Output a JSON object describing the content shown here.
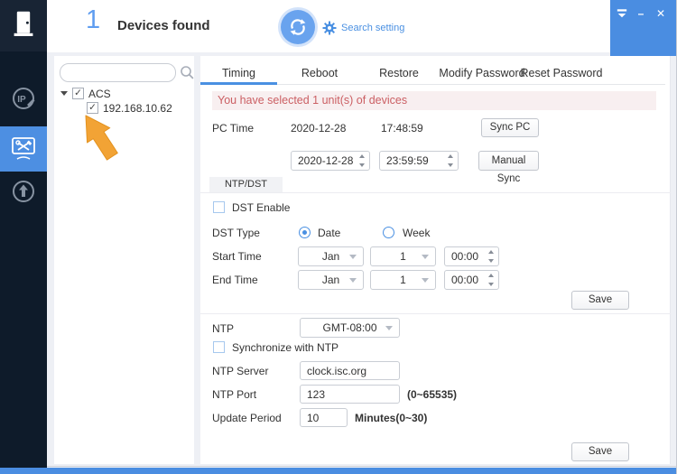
{
  "colors": {
    "accent": "#4a90e2",
    "sidebar_bg": "#0e1b2a",
    "active_tile": "#4d8fe2",
    "titlebar_box": "#4a8de1",
    "banner_bg": "#f8eff0",
    "banner_text": "#cb5f63",
    "arrow_orange": "#f2a335"
  },
  "header": {
    "count": "1",
    "title": "Devices found",
    "search_setting": "Search setting"
  },
  "window_controls": {
    "minimize": "–",
    "close": "✕"
  },
  "icons": {
    "check": "✓"
  },
  "tree": {
    "search_value": "",
    "group_label": "ACS",
    "device_label": "192.168.10.62"
  },
  "tabs": [
    {
      "label": "Timing",
      "active": true
    },
    {
      "label": "Reboot"
    },
    {
      "label": "Restore"
    },
    {
      "label": "Modify Password"
    },
    {
      "label": "Reset Password"
    }
  ],
  "timing": {
    "banner": "You have selected 1 unit(s) of devices",
    "pc_time_label": "PC Time",
    "pc_date": "2020-12-28",
    "pc_clock": "17:48:59",
    "sync_pc": "Sync PC",
    "manual_date": "2020-12-28",
    "manual_time": "23:59:59",
    "manual_sync": "Manual Sync",
    "subtab": "NTP/DST",
    "dst_enable": "DST Enable",
    "dst_type_label": "DST Type",
    "dst_date": "Date",
    "dst_week": "Week",
    "start_label": "Start Time",
    "start_month": "Jan",
    "start_day": "1",
    "start_clock": "00:00",
    "end_label": "End Time",
    "end_month": "Jan",
    "end_day": "1",
    "end_clock": "00:00",
    "save": "Save",
    "ntp_label": "NTP",
    "ntp_timezone": "GMT-08:00",
    "sync_ntp": "Synchronize with NTP",
    "ntp_server_label": "NTP Server",
    "ntp_server": "clock.isc.org",
    "ntp_port_label": "NTP Port",
    "ntp_port": "123",
    "ntp_port_hint": "(0~65535)",
    "update_label": "Update Period",
    "update_value": "10",
    "update_hint": "Minutes(0~30)",
    "save2": "Save"
  }
}
